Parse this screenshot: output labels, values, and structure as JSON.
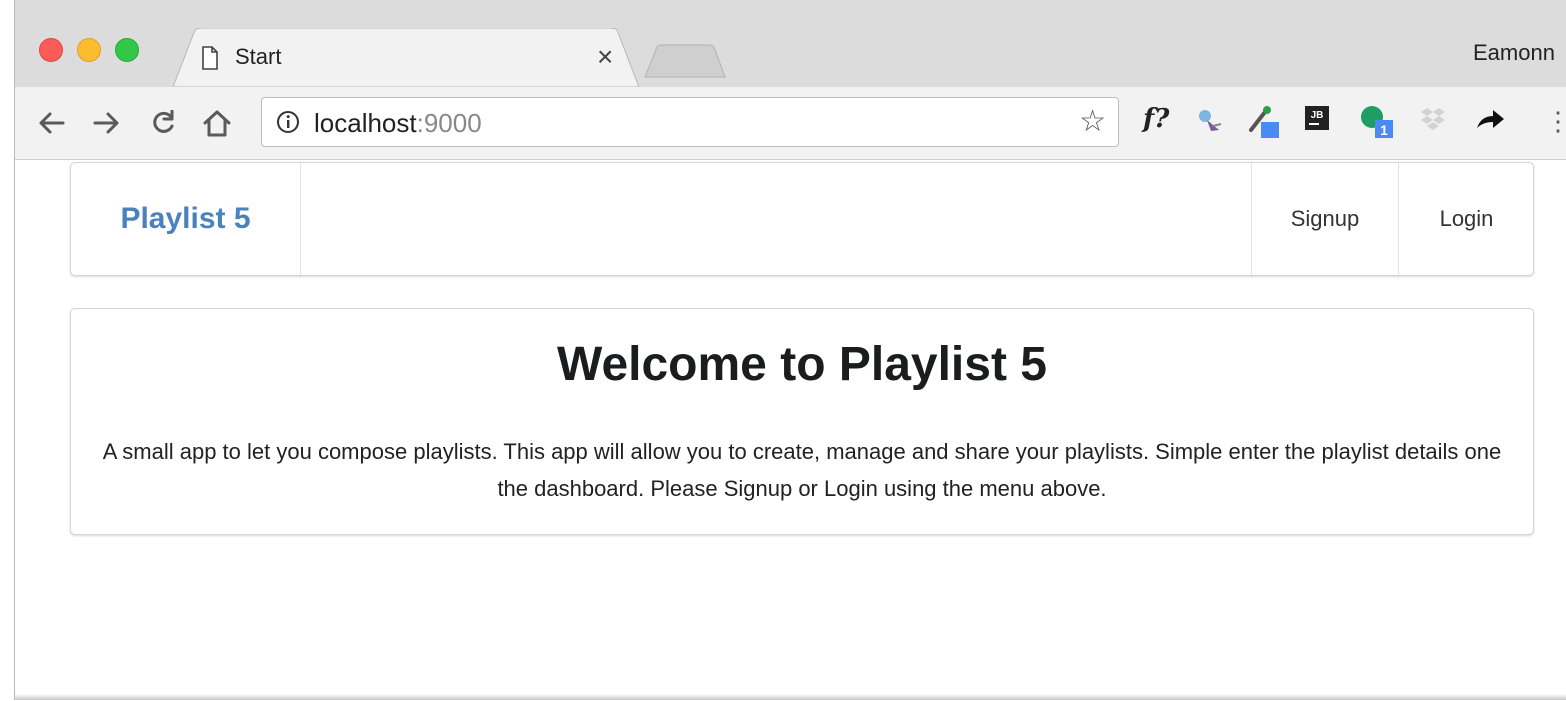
{
  "browser": {
    "tab_title": "Start",
    "tab_close": "×",
    "profile_name": "Eamonn",
    "url_host": "localhost",
    "url_port": ":9000",
    "extension_label": "f?",
    "extension_badge": "1",
    "jb_label": "JB"
  },
  "navbar": {
    "brand": "Playlist 5",
    "items": [
      "Signup",
      "Login"
    ]
  },
  "welcome": {
    "heading": "Welcome to Playlist 5",
    "body": "A small app to let you compose playlists. This app will allow you to create, manage and share your playlists. Simple enter the playlist details one the dashboard. Please Signup or Login using the menu above."
  },
  "colors": {
    "brand": "#4a82be",
    "heading": "#1b1c1d",
    "close_light": "#fc5b57",
    "minimize_light": "#fdbc2e",
    "zoom_light": "#33c748"
  }
}
